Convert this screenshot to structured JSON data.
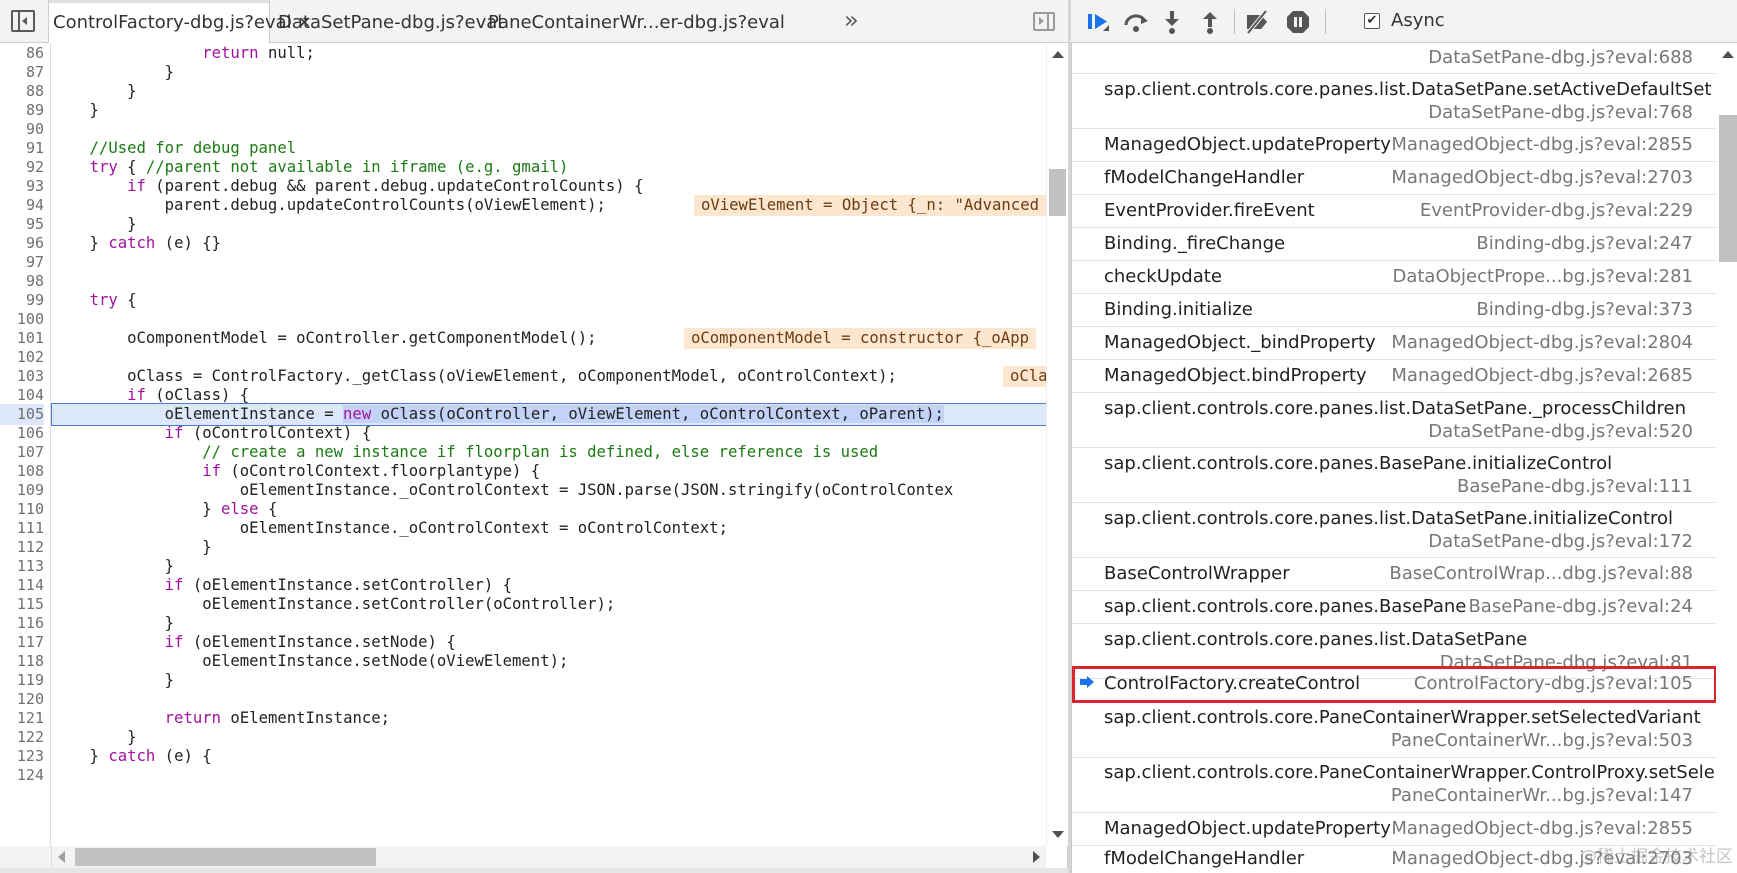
{
  "editor": {
    "tabs": [
      {
        "label": "ControlFactory-dbg.js?eval",
        "close": "✕"
      },
      {
        "label": "DataSetPane-dbg.js?eval"
      },
      {
        "label": "PaneContainerWr...er-dbg.js?eval"
      }
    ],
    "overflow_label": "»",
    "line_numbers": [
      "86",
      "87",
      "88",
      "89",
      "90",
      "91",
      "92",
      "93",
      "94",
      "95",
      "96",
      "97",
      "98",
      "99",
      "100",
      "101",
      "102",
      "103",
      "104",
      "105",
      "106",
      "107",
      "108",
      "109",
      "110",
      "111",
      "112",
      "113",
      "114",
      "115",
      "116",
      "117",
      "118",
      "119",
      "120",
      "121",
      "122",
      "123",
      "124"
    ],
    "code": {
      "l86": {
        "indent": "                ",
        "kw": "return",
        "rest": " null;"
      },
      "l87": "            }",
      "l88": "        }",
      "l89": "    }",
      "l90": "",
      "l91": "    //Used for debug panel",
      "l92": {
        "indent": "    ",
        "kw": "try",
        "mid": " { ",
        "comment": "//parent not available in iframe (e.g. gmail)"
      },
      "l93": {
        "indent": "        ",
        "kw": "if",
        "rest": " (parent.debug && parent.debug.updateControlCounts) {"
      },
      "l94": "            parent.debug.updateControlCounts(oViewElement);",
      "l94_val": "oViewElement = Object {_n: \"Advanced",
      "l95": "        }",
      "l96": {
        "pre": "    } ",
        "kw": "catch",
        "rest": " (e) {}"
      },
      "l97": "",
      "l98": "",
      "l99": {
        "indent": "    ",
        "kw": "try",
        "rest": " {"
      },
      "l100": "",
      "l101": "        oComponentModel = oController.getComponentModel();",
      "l101_val": "oComponentModel = constructor {_oApp",
      "l102": "",
      "l103": "        oClass = ControlFactory._getClass(oViewElement, oComponentModel, oControlContext);",
      "l103_val": "oCla",
      "l104": {
        "indent": "        ",
        "kw": "if",
        "rest": " (oClass) {"
      },
      "l105": {
        "pre": "            oElementInstance = ",
        "kw": "new",
        "rest": " oClass(oController, oViewElement, oControlContext, oParent);"
      },
      "l106": {
        "indent": "            ",
        "kw": "if",
        "rest": " (oControlContext) {"
      },
      "l107": "                // create a new instance if floorplan is defined, else reference is used",
      "l108": {
        "indent": "                ",
        "kw": "if",
        "rest": " (oControlContext.floorplantype) {"
      },
      "l109": "                    oElementInstance._oControlContext = JSON.parse(JSON.stringify(oControlContex",
      "l110": {
        "pre": "                } ",
        "kw": "else",
        "rest": " {"
      },
      "l111": "                    oElementInstance._oControlContext = oControlContext;",
      "l112": "                }",
      "l113": "            }",
      "l114": {
        "indent": "            ",
        "kw": "if",
        "rest": " (oElementInstance.setController) {"
      },
      "l115": "                oElementInstance.setController(oController);",
      "l116": "            }",
      "l117": {
        "indent": "            ",
        "kw": "if",
        "rest": " (oElementInstance.setNode) {"
      },
      "l118": "                oElementInstance.setNode(oViewElement);",
      "l119": "            }",
      "l120": "",
      "l121": {
        "indent": "            ",
        "kw": "return",
        "rest": " oElementInstance;"
      },
      "l122": "        }",
      "l123": {
        "pre": "    } ",
        "kw": "catch",
        "rest": " (e) {"
      },
      "l124": ""
    },
    "current_line": "105"
  },
  "debugger": {
    "async_label": "Async",
    "async_checked": true,
    "toolbar_icons": [
      "resume-icon",
      "step-over-icon",
      "step-into-icon",
      "step-out-icon",
      "deactivate-breakpoints-icon",
      "pause-on-exceptions-icon"
    ],
    "call_stack": [
      {
        "fn": "",
        "loc": "DataSetPane-dbg.js?eval:688"
      },
      {
        "fn": "sap.client.controls.core.panes.list.DataSetPane.setActiveDefaultSet",
        "loc": "DataSetPane-dbg.js?eval:768"
      },
      {
        "fn": "ManagedObject.updateProperty",
        "loc": "ManagedObject-dbg.js?eval:2855"
      },
      {
        "fn": "fModelChangeHandler",
        "loc": "ManagedObject-dbg.js?eval:2703"
      },
      {
        "fn": "EventProvider.fireEvent",
        "loc": "EventProvider-dbg.js?eval:229"
      },
      {
        "fn": "Binding._fireChange",
        "loc": "Binding-dbg.js?eval:247"
      },
      {
        "fn": "checkUpdate",
        "loc": "DataObjectPrope...bg.js?eval:281"
      },
      {
        "fn": "Binding.initialize",
        "loc": "Binding-dbg.js?eval:373"
      },
      {
        "fn": "ManagedObject._bindProperty",
        "loc": "ManagedObject-dbg.js?eval:2804"
      },
      {
        "fn": "ManagedObject.bindProperty",
        "loc": "ManagedObject-dbg.js?eval:2685"
      },
      {
        "fn": "sap.client.controls.core.panes.list.DataSetPane._processChildren",
        "loc": "DataSetPane-dbg.js?eval:520"
      },
      {
        "fn": "sap.client.controls.core.panes.BasePane.initializeControl",
        "loc": "BasePane-dbg.js?eval:111"
      },
      {
        "fn": "sap.client.controls.core.panes.list.DataSetPane.initializeControl",
        "loc": "DataSetPane-dbg.js?eval:172"
      },
      {
        "fn": "BaseControlWrapper",
        "loc": "BaseControlWrap...dbg.js?eval:88"
      },
      {
        "fn": "sap.client.controls.core.panes.BasePane",
        "loc": "BasePane-dbg.js?eval:24"
      },
      {
        "fn": "sap.client.controls.core.panes.list.DataSetPane",
        "loc": "DataSetPane-dbg.js?eval:81"
      },
      {
        "fn": "ControlFactory.createControl",
        "loc": "ControlFactory-dbg.js?eval:105",
        "current": true
      },
      {
        "fn": "sap.client.controls.core.PaneContainerWrapper.setSelectedVariant",
        "loc": "PaneContainerWr...bg.js?eval:503"
      },
      {
        "fn": "sap.client.controls.core.PaneContainerWrapper.ControlProxy.setSelectedV...",
        "loc": "PaneContainerWr...bg.js?eval:147"
      },
      {
        "fn": "ManagedObject.updateProperty",
        "loc": "ManagedObject-dbg.js?eval:2855"
      },
      {
        "fn": "fModelChangeHandler",
        "loc": "ManagedObject-dbg.js?eval:2703"
      }
    ]
  },
  "watermark": "@稀土掘金技术社区",
  "colors": {
    "accent": "#1a73e8",
    "current_frame_border": "#d9252f",
    "keyword": "#a4109f",
    "comment": "#1c7a14",
    "inline_value_bg": "#fde6cf",
    "exec_line_bg": "#dde9fb"
  }
}
